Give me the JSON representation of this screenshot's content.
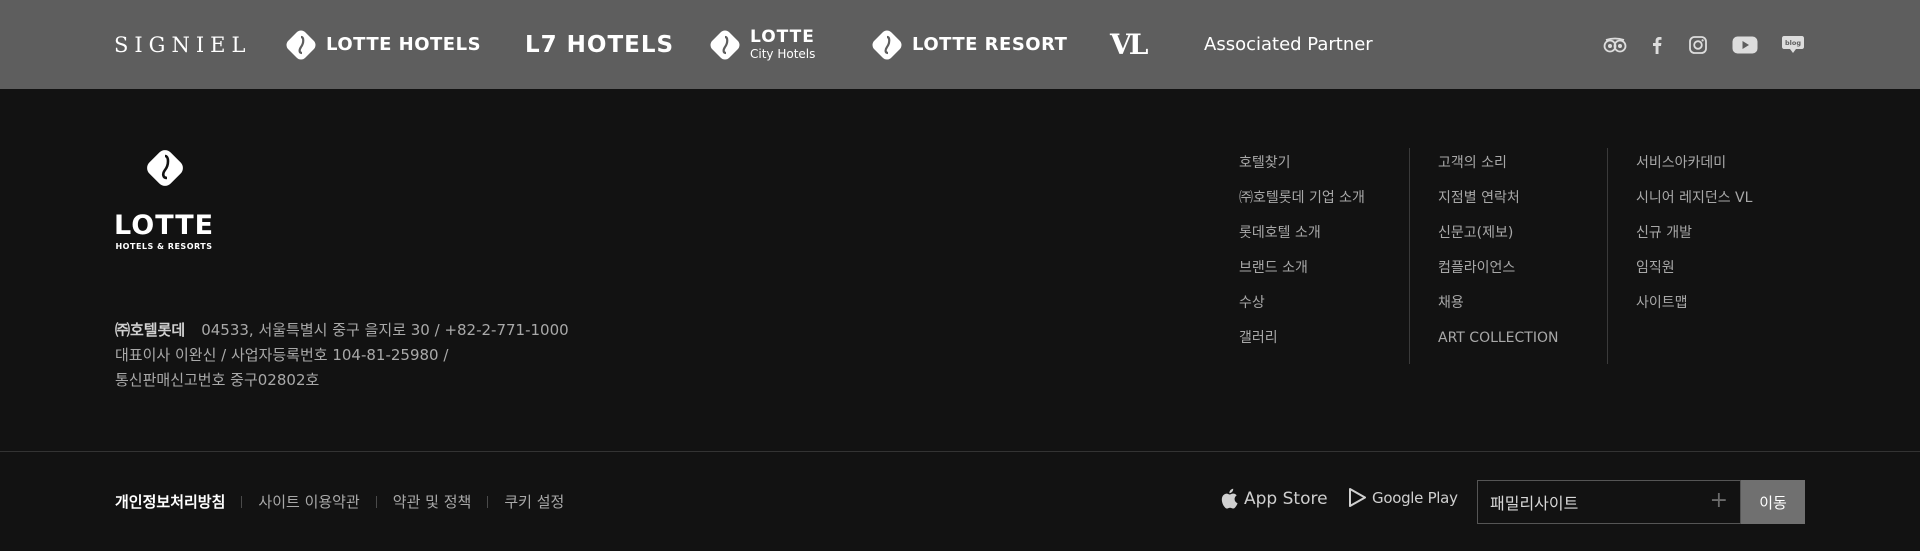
{
  "brands": {
    "signiel": "SIGNIEL",
    "lotte_hotels": "LOTTE HOTELS",
    "l7": "L7 HOTELS",
    "city_top": "LOTTE",
    "city_bottom": "City Hotels",
    "resort": "LOTTE RESORT",
    "vl": "VL",
    "associated": "Associated Partner"
  },
  "social_icons": [
    "tripadvisor-icon",
    "facebook-icon",
    "instagram-icon",
    "youtube-icon",
    "blog-icon"
  ],
  "social": {
    "blog_label": "blog"
  },
  "logo": {
    "title": "LOTTE",
    "subtitle": "HOTELS & RESORTS"
  },
  "company": {
    "name": "㈜호텔롯데",
    "address": "04533, 서울특별시 중구 을지로 30 / +82-2-771-1000",
    "ceo": "대표이사 이완신 / 사업자등록번호 104-81-25980 /",
    "telecom": "통신판매신고번호 중구02802호"
  },
  "links": {
    "col1": [
      "호텔찾기",
      "㈜호텔롯데 기업 소개",
      "롯데호텔 소개",
      "브랜드 소개",
      "수상",
      "갤러리"
    ],
    "col2": [
      "고객의 소리",
      "지점별 연락처",
      "신문고(제보)",
      "컴플라이언스",
      "채용",
      "ART COLLECTION"
    ],
    "col3": [
      "서비스아카데미",
      "시니어 레지던스 VL",
      "신규 개발",
      "임직원",
      "사이트맵"
    ]
  },
  "policy": {
    "privacy": "개인정보처리방침",
    "terms": "사이트 이용약관",
    "policies": "약관 및 정책",
    "cookies": "쿠키 설정"
  },
  "apps": {
    "apple": "App Store",
    "google": "Google Play"
  },
  "family_site": {
    "label": "패밀리사이트",
    "go": "이동"
  },
  "colors": {
    "brand_bar": "#5e5e5e",
    "footer_bg": "#121212",
    "button_bg": "#707070"
  }
}
